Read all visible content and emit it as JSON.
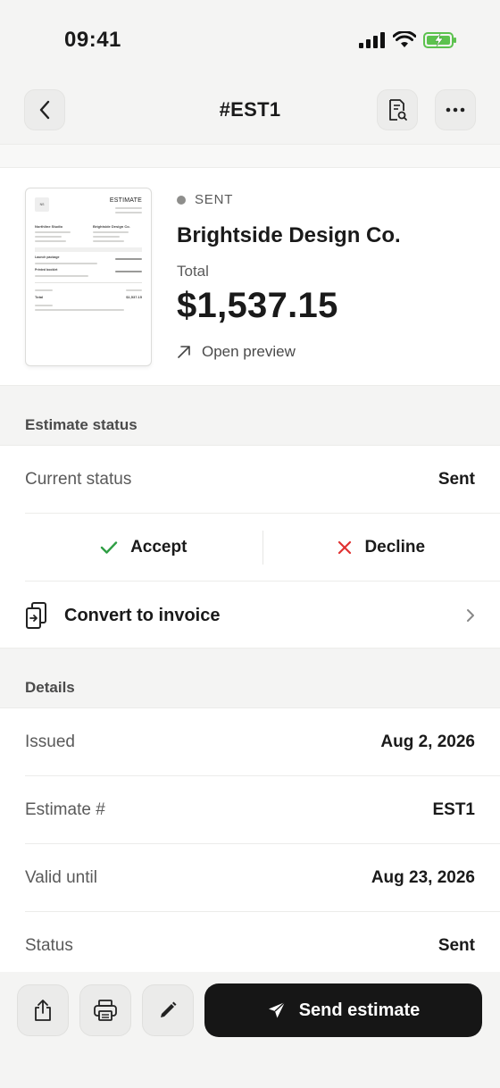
{
  "status_bar": {
    "time": "09:41"
  },
  "nav": {
    "title": "#EST1"
  },
  "hero": {
    "status": "SENT",
    "client": "Brightside Design Co.",
    "total_label": "Total",
    "total_amount": "$1,537.15",
    "preview_link": "Open preview",
    "thumbnail": {
      "heading": "ESTIMATE",
      "logo": "NS",
      "from": "Northline Studio",
      "to": "Brightside Design Co.",
      "item1": "Launch package",
      "item2": "Printed booklet",
      "total_label": "Total",
      "total_value": "$1,537.15"
    }
  },
  "estimate_status": {
    "header": "Estimate status",
    "current_label": "Current status",
    "current_value": "Sent",
    "accept": "Accept",
    "decline": "Decline",
    "convert": "Convert to invoice"
  },
  "details": {
    "header": "Details",
    "rows": [
      {
        "label": "Issued",
        "value": "Aug 2, 2026"
      },
      {
        "label": "Estimate #",
        "value": "EST1"
      },
      {
        "label": "Valid until",
        "value": "Aug 23, 2026"
      },
      {
        "label": "Status",
        "value": "Sent"
      }
    ]
  },
  "bottom": {
    "send_label": "Send estimate"
  },
  "colors": {
    "accept": "#2f9e44",
    "decline": "#e03131",
    "primary": "#161616"
  }
}
